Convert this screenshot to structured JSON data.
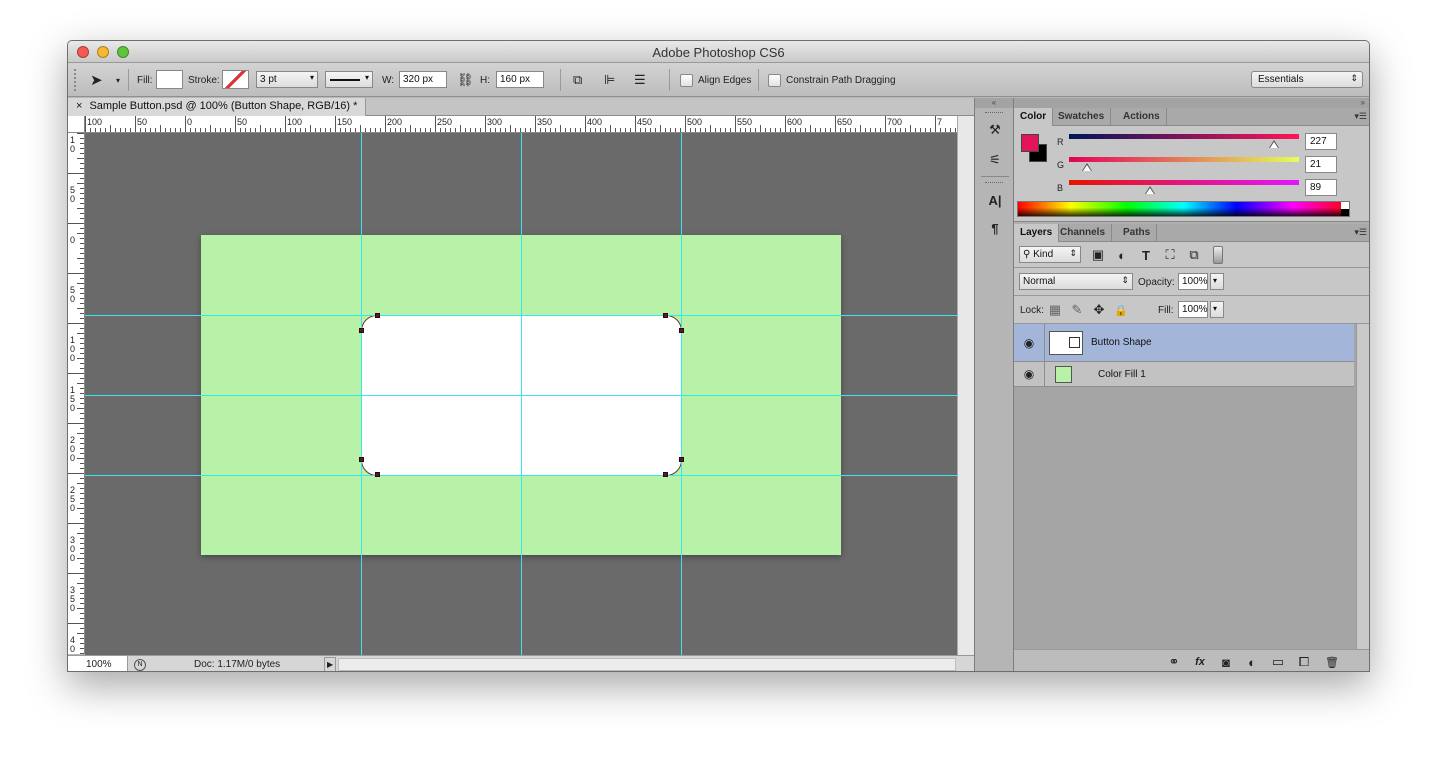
{
  "window": {
    "title": "Adobe Photoshop CS6",
    "traffic_lights": [
      "close",
      "minimize",
      "zoom"
    ]
  },
  "options_bar": {
    "fill_label": "Fill:",
    "stroke_label": "Stroke:",
    "stroke_width": "3 pt",
    "w_label": "W:",
    "w_value": "320 px",
    "h_label": "H:",
    "h_value": "160 px",
    "align_edges": "Align Edges",
    "constrain_path": "Constrain Path Dragging",
    "workspace": "Essentials"
  },
  "document": {
    "tab_title": "Sample Button.psd @ 100% (Button Shape, RGB/16) *",
    "close_glyph": "×",
    "canvas_color": "#b8f2a8",
    "shape_color": "#ffffff"
  },
  "rulers": {
    "top_labels": [
      "100",
      "50",
      "0",
      "50",
      "100",
      "150",
      "200",
      "250",
      "300",
      "350",
      "400",
      "450",
      "500",
      "550",
      "600",
      "650",
      "700",
      "7"
    ],
    "left_labels": [
      "1 0",
      "5 0",
      "0",
      "5 0",
      "1 0 0",
      "1 5 0",
      "2 0 0",
      "2 5 0",
      "3 0 0",
      "3 5 0",
      "4 0"
    ]
  },
  "status_bar": {
    "zoom": "100%",
    "doc_info": "Doc: 1.17M/0 bytes"
  },
  "color_panel": {
    "tabs": [
      "Color",
      "Swatches",
      "Actions"
    ],
    "active_tab": "Color",
    "foreground": "#e31559",
    "background": "#000000",
    "r_label": "R",
    "g_label": "G",
    "b_label": "B",
    "r": "227",
    "g": "21",
    "b": "89",
    "r_fraction": 0.89,
    "g_fraction": 0.08,
    "b_fraction": 0.35
  },
  "layers_panel": {
    "tabs": [
      "Layers",
      "Channels",
      "Paths"
    ],
    "active_tab": "Layers",
    "kind_filter": "Kind",
    "blend_mode": "Normal",
    "opacity_label": "Opacity:",
    "opacity": "100%",
    "lock_label": "Lock:",
    "fill_label": "Fill:",
    "fill": "100%",
    "layers": [
      {
        "name": "Button Shape",
        "selected": true
      },
      {
        "name": "Color Fill 1",
        "selected": false
      }
    ],
    "footer_icons": [
      "link-icon",
      "fx-icon",
      "mask-icon",
      "adjustment-icon",
      "folder-icon",
      "new-layer-icon",
      "trash-icon"
    ]
  },
  "icons": {
    "arrow": "➤",
    "link": "⛓",
    "type_tool": "A|",
    "paragraph": "¶",
    "eye": "👁",
    "lock": "🔒",
    "move": "✥",
    "trash": "🗑",
    "fx": "fx"
  }
}
